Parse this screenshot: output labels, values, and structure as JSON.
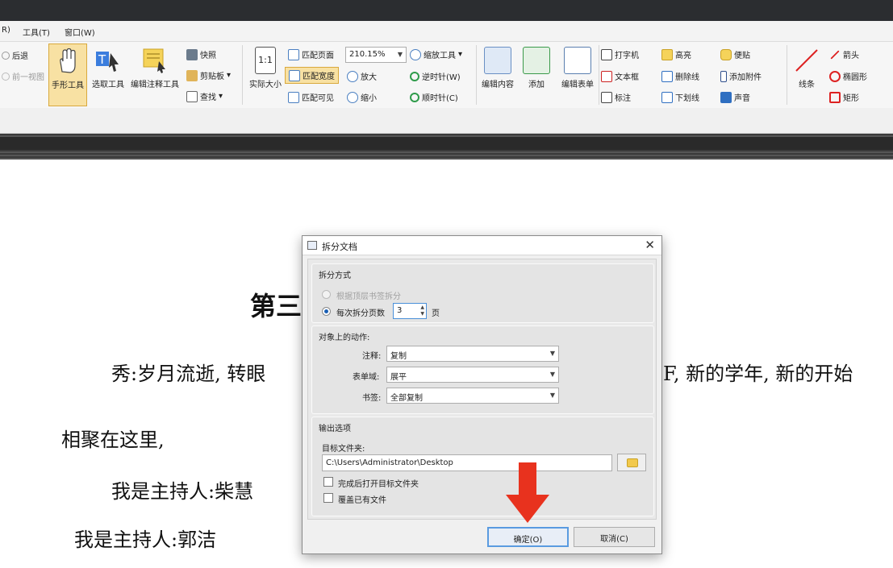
{
  "menu": [
    "R)",
    "工具(T)",
    "窗口(W)"
  ],
  "ribbon": {
    "back": "后退",
    "prev_view": "前一视图",
    "hand_tool": "手形工具",
    "select_tool": "选取工具",
    "edit_annot_tool": "编辑注释工具",
    "snapshot": "快照",
    "clipboard": "剪贴板",
    "find": "查找",
    "actual_size": "实际大小",
    "fit_page": "匹配页面",
    "fit_width": "匹配宽度",
    "fit_visible": "匹配可见",
    "zoom_value": "210.15%",
    "zoom_in": "放大",
    "zoom_out": "缩小",
    "zoom_tool": "缩放工具",
    "rotate_ccw": "逆时针(W)",
    "rotate_cw": "顺时针(C)",
    "edit_content": "编辑内容",
    "add": "添加",
    "edit_form": "编辑表单",
    "typewriter": "打字机",
    "textbox": "文本框",
    "callout": "标注",
    "highlight": "高亮",
    "strikeout": "删除线",
    "underline": "下划线",
    "sticky_note": "便贴",
    "attach_file": "添加附件",
    "sound": "声音",
    "line": "线条",
    "arrow": "箭头",
    "ellipse": "椭圆形",
    "rectangle": "矩形"
  },
  "document": {
    "heading": "第三",
    "line1_left": "秀:岁月流逝, 转眼",
    "line1_right": "F, 新的学年, 新的开始",
    "line2": "相聚在这里,",
    "line3": "我是主持人:柴慧",
    "line4": "我是主持人:郭洁"
  },
  "dialog": {
    "title": "拆分文档",
    "split_mode_header": "拆分方式",
    "by_bookmarks": "根据顶层书签拆分",
    "every_n_pages": "每次拆分页数",
    "pages_value": "3",
    "pages_unit": "页",
    "actions_header": "对象上的动作:",
    "annotations_label": "注释:",
    "annotations_value": "复制",
    "form_fields_label": "表单域:",
    "form_fields_value": "展平",
    "bookmarks_label": "书签:",
    "bookmarks_value": "全部复制",
    "output_header": "输出选项",
    "target_folder_label": "目标文件夹:",
    "target_folder_value": "C:\\Users\\Administrator\\Desktop",
    "open_after": "完成后打开目标文件夹",
    "overwrite": "覆盖已有文件",
    "ok": "确定(O)",
    "cancel": "取消(C)"
  },
  "colors": {
    "annotation_arrow": "#e8321e",
    "selection_highlight": "#f8e1a3",
    "dialog_accent": "#1a5fb4"
  }
}
